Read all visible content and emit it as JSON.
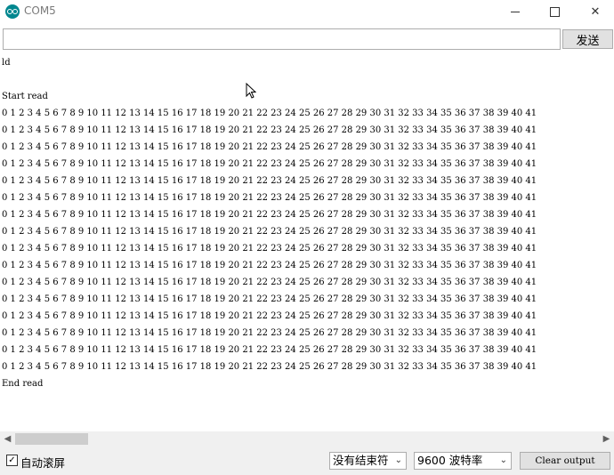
{
  "window": {
    "title": "COM5"
  },
  "send": {
    "input_value": "",
    "button_label": "发送"
  },
  "output_lines": [
    "ld",
    "",
    "Start read",
    "0 1 2 3 4 5 6 7 8 9 10 11 12 13 14 15 16 17 18 19 20 21 22 23 24 25 26 27 28 29 30 31 32 33 34 35 36 37 38 39 40 41",
    "0 1 2 3 4 5 6 7 8 9 10 11 12 13 14 15 16 17 18 19 20 21 22 23 24 25 26 27 28 29 30 31 32 33 34 35 36 37 38 39 40 41",
    "0 1 2 3 4 5 6 7 8 9 10 11 12 13 14 15 16 17 18 19 20 21 22 23 24 25 26 27 28 29 30 31 32 33 34 35 36 37 38 39 40 41",
    "0 1 2 3 4 5 6 7 8 9 10 11 12 13 14 15 16 17 18 19 20 21 22 23 24 25 26 27 28 29 30 31 32 33 34 35 36 37 38 39 40 41",
    "0 1 2 3 4 5 6 7 8 9 10 11 12 13 14 15 16 17 18 19 20 21 22 23 24 25 26 27 28 29 30 31 32 33 34 35 36 37 38 39 40 41",
    "0 1 2 3 4 5 6 7 8 9 10 11 12 13 14 15 16 17 18 19 20 21 22 23 24 25 26 27 28 29 30 31 32 33 34 35 36 37 38 39 40 41",
    "0 1 2 3 4 5 6 7 8 9 10 11 12 13 14 15 16 17 18 19 20 21 22 23 24 25 26 27 28 29 30 31 32 33 34 35 36 37 38 39 40 41",
    "0 1 2 3 4 5 6 7 8 9 10 11 12 13 14 15 16 17 18 19 20 21 22 23 24 25 26 27 28 29 30 31 32 33 34 35 36 37 38 39 40 41",
    "0 1 2 3 4 5 6 7 8 9 10 11 12 13 14 15 16 17 18 19 20 21 22 23 24 25 26 27 28 29 30 31 32 33 34 35 36 37 38 39 40 41",
    "0 1 2 3 4 5 6 7 8 9 10 11 12 13 14 15 16 17 18 19 20 21 22 23 24 25 26 27 28 29 30 31 32 33 34 35 36 37 38 39 40 41",
    "0 1 2 3 4 5 6 7 8 9 10 11 12 13 14 15 16 17 18 19 20 21 22 23 24 25 26 27 28 29 30 31 32 33 34 35 36 37 38 39 40 41",
    "0 1 2 3 4 5 6 7 8 9 10 11 12 13 14 15 16 17 18 19 20 21 22 23 24 25 26 27 28 29 30 31 32 33 34 35 36 37 38 39 40 41",
    "0 1 2 3 4 5 6 7 8 9 10 11 12 13 14 15 16 17 18 19 20 21 22 23 24 25 26 27 28 29 30 31 32 33 34 35 36 37 38 39 40 41",
    "0 1 2 3 4 5 6 7 8 9 10 11 12 13 14 15 16 17 18 19 20 21 22 23 24 25 26 27 28 29 30 31 32 33 34 35 36 37 38 39 40 41",
    "0 1 2 3 4 5 6 7 8 9 10 11 12 13 14 15 16 17 18 19 20 21 22 23 24 25 26 27 28 29 30 31 32 33 34 35 36 37 38 39 40 41",
    "0 1 2 3 4 5 6 7 8 9 10 11 12 13 14 15 16 17 18 19 20 21 22 23 24 25 26 27 28 29 30 31 32 33 34 35 36 37 38 39 40 41",
    "End read"
  ],
  "statusbar": {
    "autoscroll_checked": true,
    "autoscroll_label": "自动滚屏",
    "line_ending_selected": "没有结束符",
    "baud_selected": "9600 波特率",
    "clear_label": "Clear output"
  },
  "icons": {
    "app": "arduino-icon",
    "minimize": "minimize-icon",
    "maximize": "maximize-icon",
    "close": "close-icon",
    "scroll_left": "chevron-left-icon",
    "scroll_right": "chevron-right-icon",
    "dropdown": "chevron-down-icon",
    "checkbox": "check-icon",
    "cursor": "mouse-pointer-icon"
  },
  "colors": {
    "brand": "#00878f",
    "chrome": "#f0f0f0",
    "button": "#e1e1e1"
  }
}
